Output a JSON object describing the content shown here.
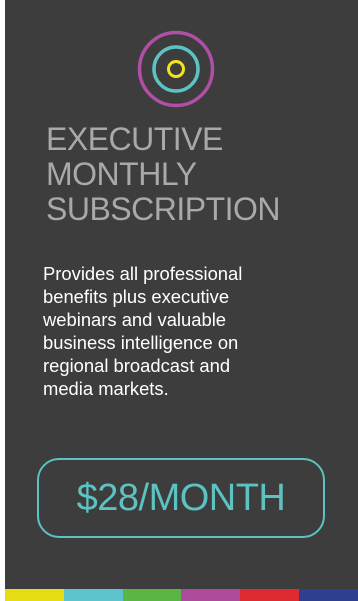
{
  "card": {
    "title_lines": [
      "EXECUTIVE",
      "MONTHLY",
      "SUBSCRIPTION"
    ],
    "description_lines": [
      "Provides all professional",
      "benefits plus executive",
      "webinars and valuable",
      "business intelligence on",
      "regional broadcast and",
      "media markets."
    ],
    "price": "$28/MONTH"
  },
  "logo": {
    "icon": "target-rings-icon",
    "outer_ring_color": "#b04fa5",
    "middle_ring_color": "#5cc2c2",
    "inner_ring_color": "#f2e61a"
  },
  "colors": {
    "background": "#3d3d3d",
    "title": "#a9a9a9",
    "description": "#ffffff",
    "price_accent": "#5cc2c2"
  },
  "stripe_colors": [
    "#e6dc14",
    "#5cc2cc",
    "#5ab545",
    "#ad4c9c",
    "#e02a32",
    "#2e3f8f"
  ]
}
